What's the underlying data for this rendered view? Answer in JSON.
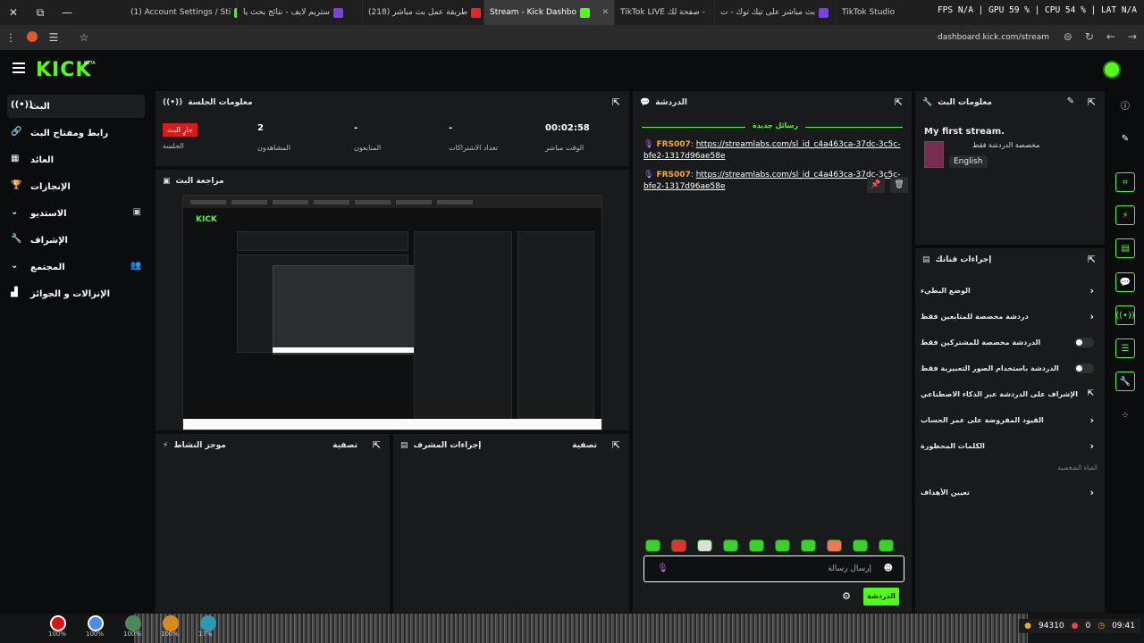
{
  "browser": {
    "tabs": [
      {
        "title": "(1) Account Settings / Sti"
      },
      {
        "title": "ستريم لايف - نتائج بحث يا"
      },
      {
        "title": "(218) طريقة عمل بث مباشر"
      },
      {
        "title": "Stream - Kick Dashbo",
        "active": true
      },
      {
        "title": "TikTok LIVE صفحة لك -"
      },
      {
        "title": "بث مباشر على تيك توك - ت"
      },
      {
        "title": "TikTok Studio"
      }
    ],
    "overlay_stats": "FPS N/A | GPU 59 % | CPU 54 % | LAT N/A",
    "url": "dashboard.kick.com/stream"
  },
  "kick": {
    "logo": "KICK",
    "beta": "BETA"
  },
  "sidebar": {
    "items": [
      {
        "label": "البث",
        "icon": "broadcast-icon"
      },
      {
        "label": "رابط ومفتاح البث",
        "icon": "link-icon"
      },
      {
        "label": "العائد",
        "icon": "revenue-icon"
      },
      {
        "label": "الإنجازات",
        "icon": "trophy-icon"
      },
      {
        "label": "الاستديو",
        "icon": "studio-icon"
      },
      {
        "label": "الإشراف",
        "icon": "wrench-icon"
      },
      {
        "label": "المجتمع",
        "icon": "community-icon"
      },
      {
        "label": "الإنزالات و الجوائز",
        "icon": "drops-icon"
      }
    ]
  },
  "session": {
    "title": "معلومات الجلسة",
    "live_badge": "جارٍ البث",
    "stats": [
      {
        "value": "",
        "label": "الجلسة"
      },
      {
        "value": "2",
        "label": "المشاهدون"
      },
      {
        "value": "-",
        "label": "المتابعون"
      },
      {
        "value": "-",
        "label": "تعداد الاشتراكات"
      },
      {
        "value": "00:02:58",
        "label": "الوقت مباشر"
      }
    ]
  },
  "preview": {
    "title": "مراجعة البث"
  },
  "activity": {
    "title": "موجز النشاط",
    "filter": "تصفية"
  },
  "modactions": {
    "title": "إجراءات المشرف",
    "filter": "تصفية"
  },
  "chat": {
    "title": "الدردشة",
    "new_messages": "رسائل جديدة",
    "messages": [
      {
        "user": "FRS007",
        "text": "https://streamlabs.com/sl_id_c4a463ca-37dc-3c5c-bfe2-1317d96ae58e"
      },
      {
        "user": "FRS007",
        "text": "https://streamlabs.com/sl_id_c4a463ca-37dc-3c5c-bfe2-1317d96ae58e"
      }
    ],
    "input_placeholder": "إرسال رسالة",
    "send_label": "الدردشة"
  },
  "stream_info": {
    "title": "معلومات البث",
    "stream_title": "My first stream.",
    "category": "مخصصة الدردشة فقط",
    "language": "English"
  },
  "quick_actions": {
    "title": "إجراءات قناتك",
    "items": [
      {
        "label": "الوضع البطيء",
        "control": "arrow"
      },
      {
        "label": "دردشة مخصصة للمتابعين فقط",
        "control": "arrow"
      },
      {
        "label": "الدردشة مخصصة للمشتركين فقط",
        "control": "toggle",
        "on": false
      },
      {
        "label": "الدردشة باستخدام الصور التعبيرية فقط",
        "control": "toggle",
        "on": false
      },
      {
        "label": "الإشراف على الدردشة عبر الذكاء الاصطناعي",
        "control": "external"
      },
      {
        "label": "القيود المفروضة على عمر الحساب",
        "control": "arrow"
      },
      {
        "label": "الكلمات المحظورة",
        "control": "arrow"
      }
    ],
    "section_label": "القناة الشخصية",
    "goals_label": "تعيين الأهداف"
  },
  "taskbar": {
    "percents": [
      "100%",
      "100%",
      "100%",
      "100%",
      "17%"
    ],
    "tray_coins": "94310",
    "tray_zero": "0",
    "clock": "09:41"
  }
}
